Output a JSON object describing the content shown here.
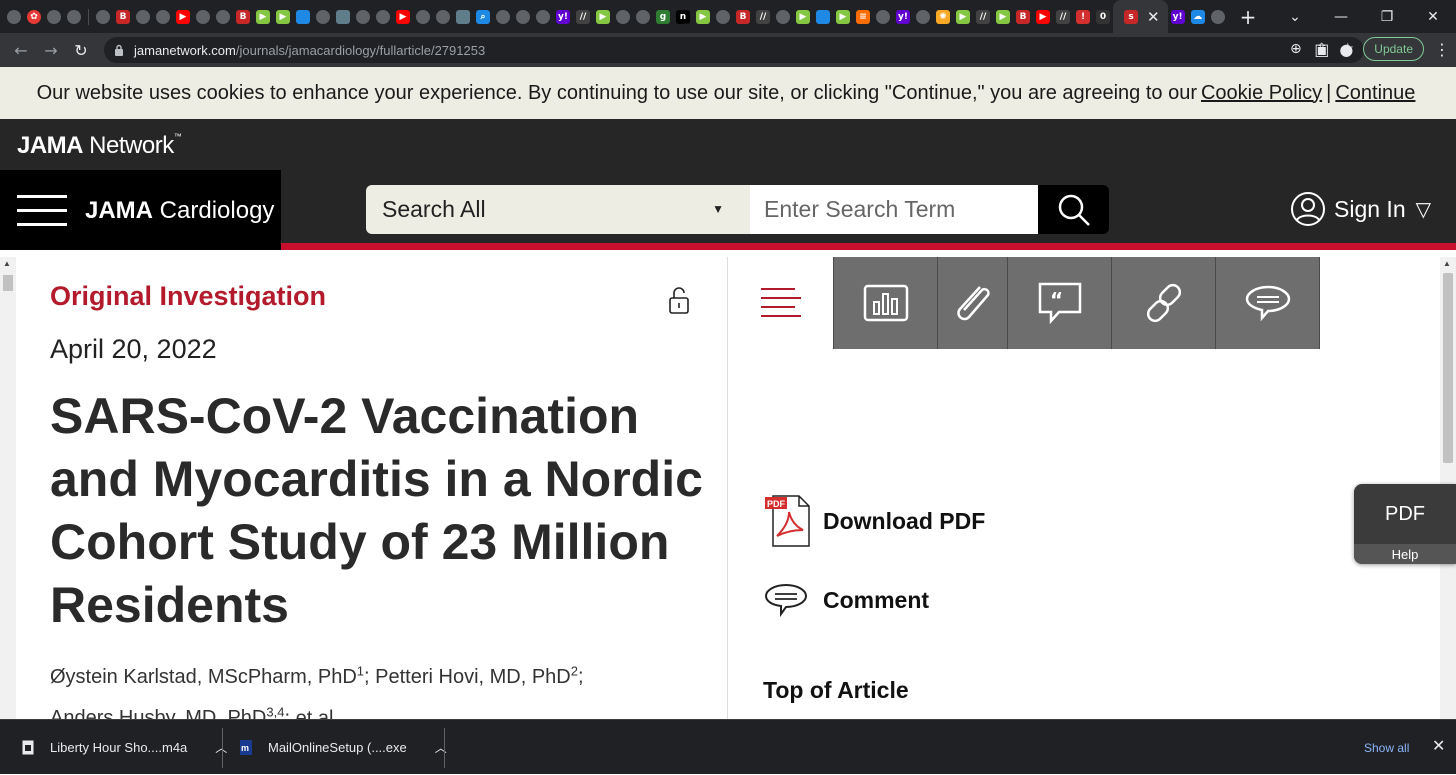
{
  "browser": {
    "url_host": "jamanetwork.com",
    "url_path": "/journals/jamacardiology/fullarticle/2791253",
    "update_label": "Update",
    "tab_close": "✕",
    "new_tab": "+",
    "favicons": [
      {
        "name": "globe-favicon",
        "color": "#5f6368",
        "glyph": "",
        "round": true
      },
      {
        "name": "red-flower-favicon",
        "color": "#e53935",
        "glyph": "✿",
        "round": true
      },
      {
        "name": "globe-favicon",
        "color": "#5f6368",
        "glyph": "",
        "round": true
      },
      {
        "name": "globe-favicon",
        "color": "#5f6368",
        "glyph": "",
        "round": true
      },
      {
        "name": "sep",
        "color": "",
        "glyph": ""
      },
      {
        "name": "globe-favicon",
        "color": "#5f6368",
        "glyph": "",
        "round": true
      },
      {
        "name": "b-favicon",
        "color": "#c62828",
        "glyph": "B"
      },
      {
        "name": "globe-favicon",
        "color": "#5f6368",
        "glyph": "",
        "round": true
      },
      {
        "name": "globe-favicon",
        "color": "#5f6368",
        "glyph": "",
        "round": true
      },
      {
        "name": "youtube-favicon",
        "color": "#ff0000",
        "glyph": "▶"
      },
      {
        "name": "globe-favicon",
        "color": "#5f6368",
        "glyph": "",
        "round": true
      },
      {
        "name": "globe-favicon",
        "color": "#5f6368",
        "glyph": "",
        "round": true
      },
      {
        "name": "b-favicon",
        "color": "#c62828",
        "glyph": "B"
      },
      {
        "name": "rumble-favicon",
        "color": "#85c742",
        "glyph": "▶"
      },
      {
        "name": "rumble-favicon",
        "color": "#85c742",
        "glyph": "▶"
      },
      {
        "name": "shield-favicon",
        "color": "#1e88e5",
        "glyph": ""
      },
      {
        "name": "globe-favicon",
        "color": "#5f6368",
        "glyph": "",
        "round": true
      },
      {
        "name": "doc-favicon",
        "color": "#607d8b",
        "glyph": ""
      },
      {
        "name": "globe-favicon",
        "color": "#5f6368",
        "glyph": "",
        "round": true
      },
      {
        "name": "globe-favicon",
        "color": "#5f6368",
        "glyph": "",
        "round": true
      },
      {
        "name": "youtube-favicon",
        "color": "#ff0000",
        "glyph": "▶"
      },
      {
        "name": "globe-favicon",
        "color": "#5f6368",
        "glyph": "",
        "round": true
      },
      {
        "name": "globe-favicon",
        "color": "#5f6368",
        "glyph": "",
        "round": true
      },
      {
        "name": "doc-favicon",
        "color": "#607d8b",
        "glyph": ""
      },
      {
        "name": "search-favicon",
        "color": "#1e88e5",
        "glyph": "⌕"
      },
      {
        "name": "globe-favicon",
        "color": "#5f6368",
        "glyph": "",
        "round": true
      },
      {
        "name": "globe-favicon",
        "color": "#5f6368",
        "glyph": "",
        "round": true
      },
      {
        "name": "globe-favicon",
        "color": "#5f6368",
        "glyph": "",
        "round": true
      },
      {
        "name": "yahoo-favicon",
        "color": "#6001d2",
        "glyph": "y!"
      },
      {
        "name": "ul-favicon",
        "color": "#424242",
        "glyph": "//"
      },
      {
        "name": "rumble-favicon",
        "color": "#85c742",
        "glyph": "▶"
      },
      {
        "name": "globe-favicon",
        "color": "#5f6368",
        "glyph": "",
        "round": true
      },
      {
        "name": "globe-favicon",
        "color": "#5f6368",
        "glyph": "",
        "round": true
      },
      {
        "name": "g-favicon",
        "color": "#2e7d32",
        "glyph": "g"
      },
      {
        "name": "n-favicon",
        "color": "#000000",
        "glyph": "n"
      },
      {
        "name": "rumble-favicon",
        "color": "#85c742",
        "glyph": "▶"
      },
      {
        "name": "globe-favicon",
        "color": "#5f6368",
        "glyph": "",
        "round": true
      },
      {
        "name": "b-favicon",
        "color": "#c62828",
        "glyph": "B"
      },
      {
        "name": "ul-favicon",
        "color": "#424242",
        "glyph": "//"
      },
      {
        "name": "globe-favicon",
        "color": "#5f6368",
        "glyph": "",
        "round": true
      },
      {
        "name": "rumble-favicon",
        "color": "#85c742",
        "glyph": "▶"
      },
      {
        "name": "shield-favicon",
        "color": "#1e88e5",
        "glyph": ""
      },
      {
        "name": "rumble-favicon",
        "color": "#85c742",
        "glyph": "▶"
      },
      {
        "name": "stack-favicon",
        "color": "#ff6d00",
        "glyph": "≡"
      },
      {
        "name": "globe-favicon",
        "color": "#5f6368",
        "glyph": "",
        "round": true
      },
      {
        "name": "yahoo-favicon",
        "color": "#6001d2",
        "glyph": "y!"
      },
      {
        "name": "globe-favicon",
        "color": "#5f6368",
        "glyph": "",
        "round": true
      },
      {
        "name": "sun-favicon",
        "color": "#f9a825",
        "glyph": "✺"
      },
      {
        "name": "rumble-favicon",
        "color": "#85c742",
        "glyph": "▶"
      },
      {
        "name": "ul-favicon",
        "color": "#424242",
        "glyph": "//"
      },
      {
        "name": "rumble-favicon",
        "color": "#85c742",
        "glyph": "▶"
      },
      {
        "name": "b-favicon",
        "color": "#c62828",
        "glyph": "B"
      },
      {
        "name": "youtube-favicon",
        "color": "#ff0000",
        "glyph": "▶"
      },
      {
        "name": "ul-favicon",
        "color": "#424242",
        "glyph": "//"
      },
      {
        "name": "red-favicon",
        "color": "#d32f2f",
        "glyph": "!"
      },
      {
        "name": "zero-favicon",
        "color": "#333333",
        "glyph": "0"
      }
    ],
    "active_tab_icon": {
      "name": "s-favicon",
      "color": "#c62828",
      "glyph": "s"
    },
    "after_icons": [
      {
        "name": "yahoo-favicon",
        "color": "#6001d2",
        "glyph": "y!"
      },
      {
        "name": "cloud-favicon",
        "color": "#1e88e5",
        "glyph": "☁"
      },
      {
        "name": "globe-favicon",
        "color": "#5f6368",
        "glyph": "",
        "round": true
      }
    ]
  },
  "cookie": {
    "message": "Our website uses cookies to enhance your experience. By continuing to use our site, or clicking \"Continue,\" you are agreeing to our",
    "policy_link": "Cookie Policy",
    "separator": "|",
    "continue_link": "Continue"
  },
  "header": {
    "network_bold": "JAMA",
    "network_rest": " Network",
    "network_tm": "™",
    "journal_bold": "JAMA",
    "journal_rest": " Cardiology",
    "search_scope": "Search All",
    "search_placeholder": "Enter Search Term",
    "sign_in": "Sign In"
  },
  "article": {
    "kicker": "Original Investigation",
    "date": "April 20, 2022",
    "title": "SARS-CoV-2 Vaccination and Myocarditis in a Nordic Cohort Study of 23 Million Residents",
    "authors": [
      {
        "name": "Øystein Karlstad, MScPharm, PhD",
        "sup": "1",
        "sep": "; "
      },
      {
        "name": "Petteri Hovi, MD, PhD",
        "sup": "2",
        "sep": ";"
      },
      {
        "name": "Anders Husby, MD, PhD",
        "sup": "3,4",
        "sep": "; "
      }
    ],
    "et_al": "et al"
  },
  "sidebar": {
    "download_pdf": "Download PDF",
    "comment": "Comment",
    "top_of_article": "Top of Article",
    "pdf_icon_label": "PDF"
  },
  "floating": {
    "pdf": "PDF",
    "help": "Help"
  },
  "downloads": {
    "items": [
      {
        "name": "Liberty Hour Sho....m4a"
      },
      {
        "name": "MailOnlineSetup (....exe"
      }
    ],
    "show_all": "Show all",
    "close": "✕"
  },
  "colors": {
    "brand_red": "#c8102e",
    "kicker_red": "#b31b2d",
    "header_dark": "#262626"
  }
}
